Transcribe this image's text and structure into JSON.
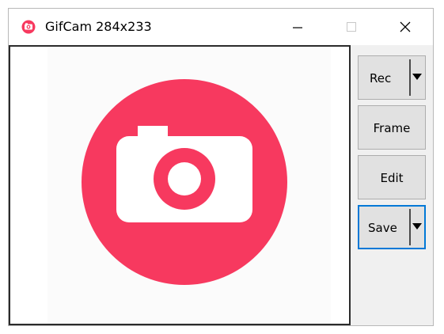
{
  "window": {
    "title": "GifCam 284x233",
    "app_icon": "gifcam-camera-icon",
    "controls": {
      "minimize_icon": "minimize-icon",
      "maximize_icon": "maximize-icon",
      "close_icon": "close-icon"
    }
  },
  "capture_area": {
    "content_icon": "camera-logo",
    "logo_color": "#f7395f"
  },
  "toolbar": {
    "rec_label": "Rec",
    "frame_label": "Frame",
    "edit_label": "Edit",
    "save_label": "Save",
    "dropdown_icon": "dropdown-arrow-icon",
    "focus_color": "#0078d7"
  }
}
